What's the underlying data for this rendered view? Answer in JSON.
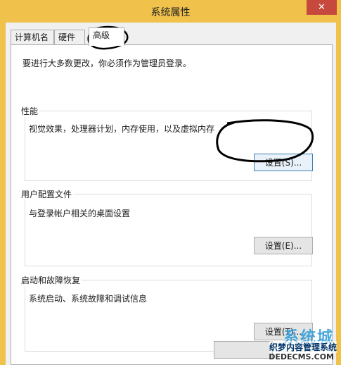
{
  "window": {
    "title": "系统属性",
    "close_glyph": "✕"
  },
  "tabs": [
    {
      "label": "计算机名"
    },
    {
      "label": "硬件"
    },
    {
      "label": "高级",
      "active": true
    }
  ],
  "advanced": {
    "intro": "要进行大多数更改，你必须作为管理员登录。",
    "performance": {
      "title": "性能",
      "description": "视觉效果，处理器计划，内存使用，以及虚拟内存",
      "button": "设置(S)..."
    },
    "user_profiles": {
      "title": "用户配置文件",
      "description": "与登录帐户相关的桌面设置",
      "button": "设置(E)..."
    },
    "startup_recovery": {
      "title": "启动和故障恢复",
      "description": "系统启动、系统故障和调试信息",
      "button": "设置(T)..."
    }
  },
  "watermark": {
    "logo_text": "系统城",
    "site_name": "织梦内容管理系统",
    "url_text": "DEDECMS.COM"
  },
  "colors": {
    "title_bar": "#f0c14b",
    "close_button": "#c7483c",
    "focused_border": "#3c7fb1"
  }
}
